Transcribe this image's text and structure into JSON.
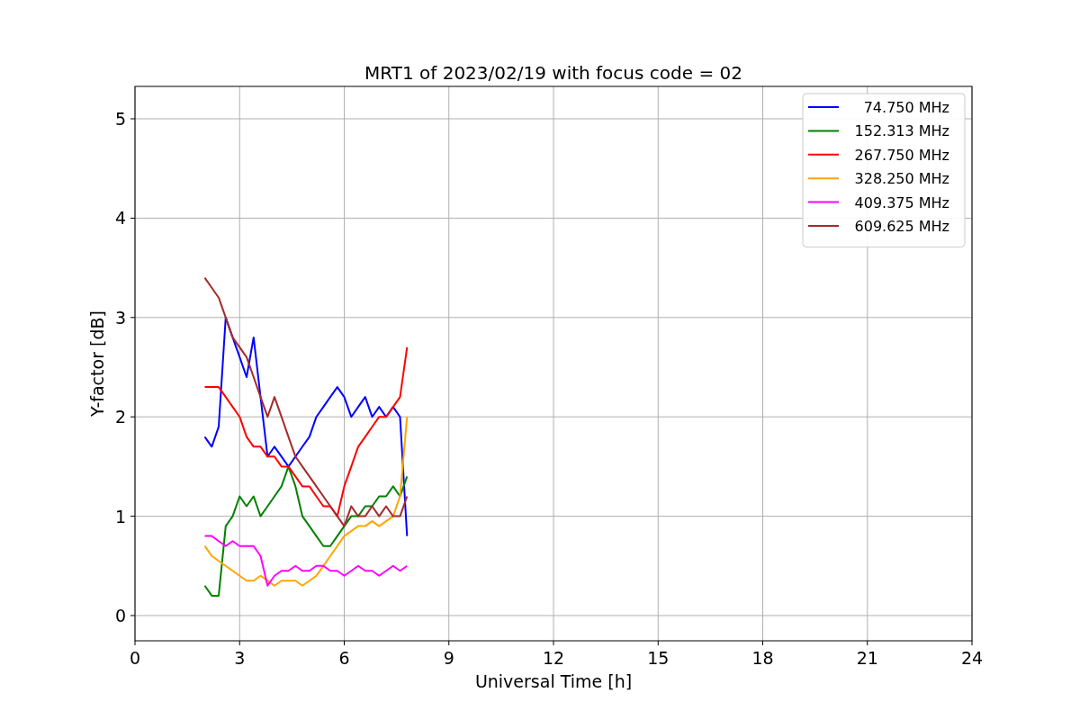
{
  "figure": {
    "chart_data": {
      "type": "line",
      "title": "MRT1 of 2023/02/19 with focus code = 02",
      "xlabel": "Universal Time [h]",
      "ylabel": "Y-factor [dB]",
      "x": [
        2.0,
        2.2,
        2.4,
        2.6,
        2.8,
        3.0,
        3.2,
        3.4,
        3.6,
        3.8,
        4.0,
        4.2,
        4.4,
        4.6,
        4.8,
        5.0,
        5.2,
        5.4,
        5.6,
        5.8,
        6.0,
        6.2,
        6.4,
        6.6,
        6.8,
        7.0,
        7.2,
        7.4,
        7.6,
        7.8
      ],
      "series": [
        {
          "name": "74.750 MHz",
          "color": "#0000ff",
          "values": [
            1.8,
            1.7,
            1.9,
            3.0,
            2.8,
            2.6,
            2.4,
            2.8,
            2.2,
            1.6,
            1.7,
            1.6,
            1.5,
            1.6,
            1.7,
            1.8,
            2.0,
            2.1,
            2.2,
            2.3,
            2.2,
            2.0,
            2.1,
            2.2,
            2.0,
            2.1,
            2.0,
            2.1,
            2.0,
            0.8
          ]
        },
        {
          "name": "152.313 MHz",
          "color": "#008000",
          "values": [
            0.3,
            0.2,
            0.2,
            0.9,
            1.0,
            1.2,
            1.1,
            1.2,
            1.0,
            1.1,
            1.2,
            1.3,
            1.5,
            1.3,
            1.0,
            0.9,
            0.8,
            0.7,
            0.7,
            0.8,
            0.9,
            1.0,
            1.0,
            1.1,
            1.1,
            1.2,
            1.2,
            1.3,
            1.2,
            1.4
          ]
        },
        {
          "name": "267.750 MHz",
          "color": "#ff0000",
          "values": [
            2.3,
            2.3,
            2.3,
            2.2,
            2.1,
            2.0,
            1.8,
            1.7,
            1.7,
            1.6,
            1.6,
            1.5,
            1.5,
            1.4,
            1.3,
            1.3,
            1.2,
            1.1,
            1.1,
            1.0,
            1.3,
            1.5,
            1.7,
            1.8,
            1.9,
            2.0,
            2.0,
            2.1,
            2.2,
            2.7
          ]
        },
        {
          "name": "328.250 MHz",
          "color": "#ffa500",
          "values": [
            0.7,
            0.6,
            0.55,
            0.5,
            0.45,
            0.4,
            0.35,
            0.35,
            0.4,
            0.35,
            0.3,
            0.35,
            0.35,
            0.35,
            0.3,
            0.35,
            0.4,
            0.5,
            0.6,
            0.7,
            0.8,
            0.85,
            0.9,
            0.9,
            0.95,
            0.9,
            0.95,
            1.0,
            1.2,
            2.0
          ]
        },
        {
          "name": "409.375 MHz",
          "color": "#ff00ff",
          "values": [
            0.8,
            0.8,
            0.75,
            0.7,
            0.75,
            0.7,
            0.7,
            0.7,
            0.6,
            0.3,
            0.4,
            0.45,
            0.45,
            0.5,
            0.45,
            0.45,
            0.5,
            0.5,
            0.45,
            0.45,
            0.4,
            0.45,
            0.5,
            0.45,
            0.45,
            0.4,
            0.45,
            0.5,
            0.45,
            0.5
          ]
        },
        {
          "name": "609.625 MHz",
          "color": "#a52a2a",
          "values": [
            3.4,
            3.3,
            3.2,
            3.0,
            2.8,
            2.7,
            2.6,
            2.4,
            2.2,
            2.0,
            2.2,
            2.0,
            1.8,
            1.6,
            1.5,
            1.4,
            1.3,
            1.2,
            1.1,
            1.0,
            0.9,
            1.1,
            1.0,
            1.0,
            1.1,
            1.0,
            1.1,
            1.0,
            1.0,
            1.2
          ]
        }
      ],
      "xlim": [
        0,
        24
      ],
      "ylim": [
        -0.254,
        5.326
      ],
      "xticks": [
        0,
        3,
        6,
        9,
        12,
        15,
        18,
        21,
        24
      ],
      "yticks": [
        0,
        1,
        2,
        3,
        4,
        5
      ],
      "grid": true,
      "legend": true
    }
  }
}
